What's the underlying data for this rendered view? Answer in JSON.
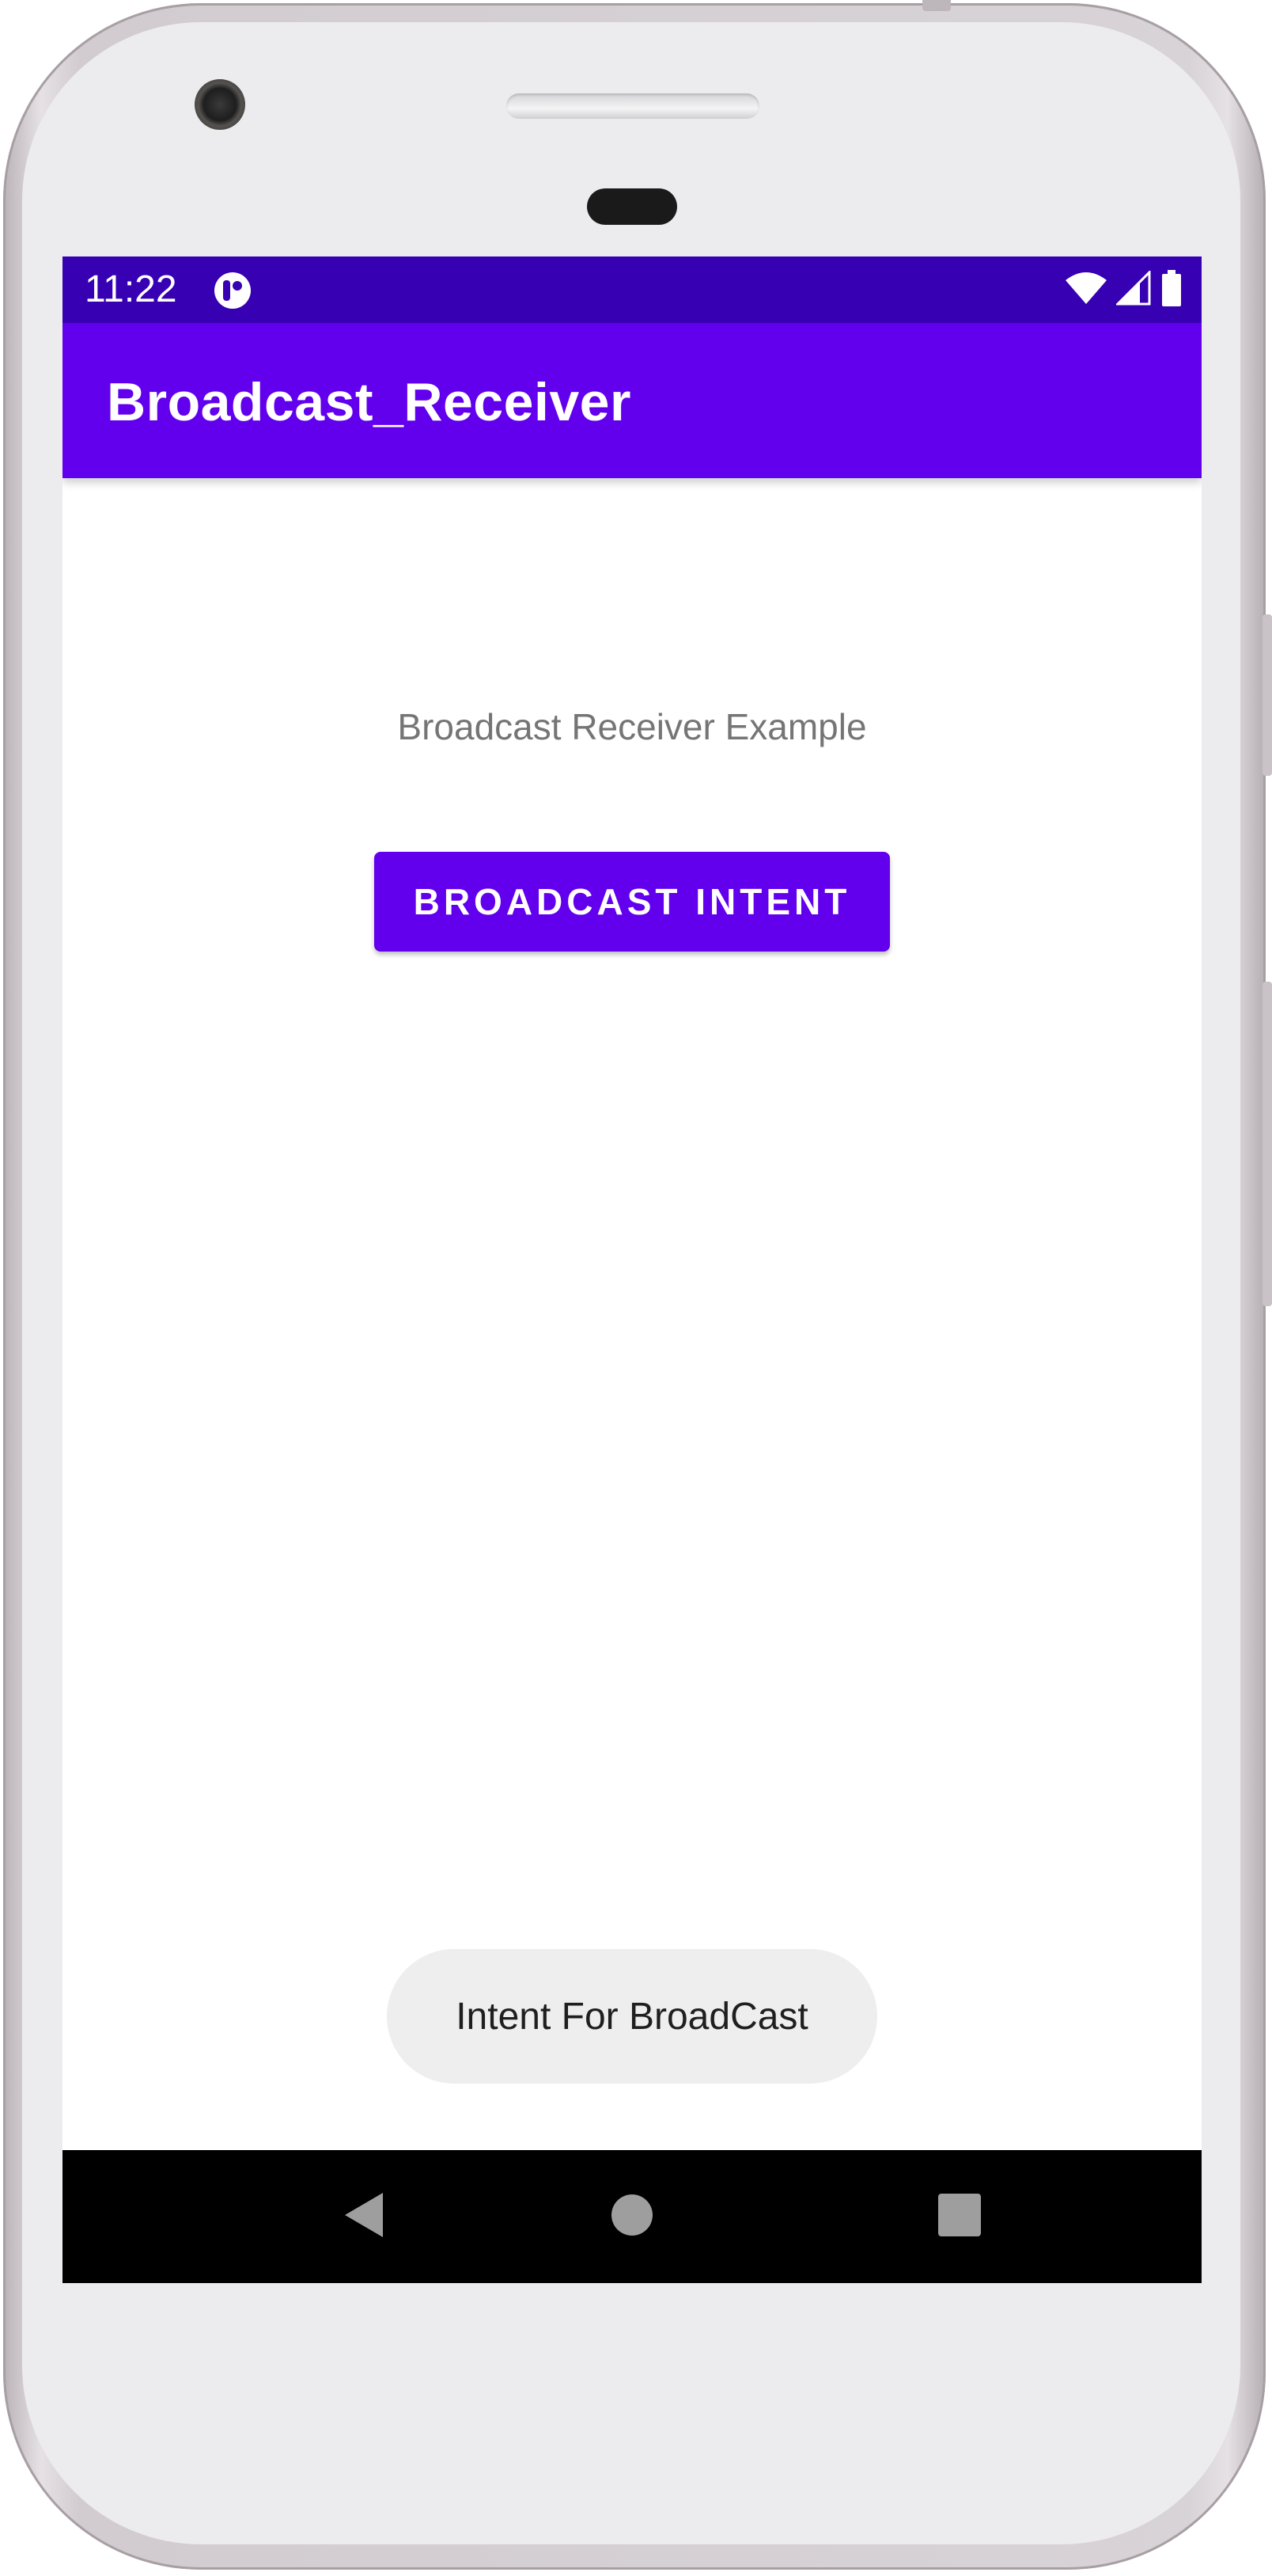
{
  "status_bar": {
    "time": "11:22",
    "icons": [
      "app-notification-icon",
      "wifi-icon",
      "cellular-signal-icon",
      "battery-icon"
    ]
  },
  "app_bar": {
    "title": "Broadcast_Receiver"
  },
  "content": {
    "label": "Broadcast Receiver Example",
    "button_label": "BROADCAST INTENT"
  },
  "toast": {
    "message": "Intent For BroadCast"
  },
  "navigation": {
    "icons": [
      "back-icon",
      "home-icon",
      "recents-icon"
    ]
  },
  "colors": {
    "status_bar": "#3700b3",
    "primary": "#6200ee",
    "toast_background": "#eeeeee",
    "nav_bar": "#000000"
  }
}
